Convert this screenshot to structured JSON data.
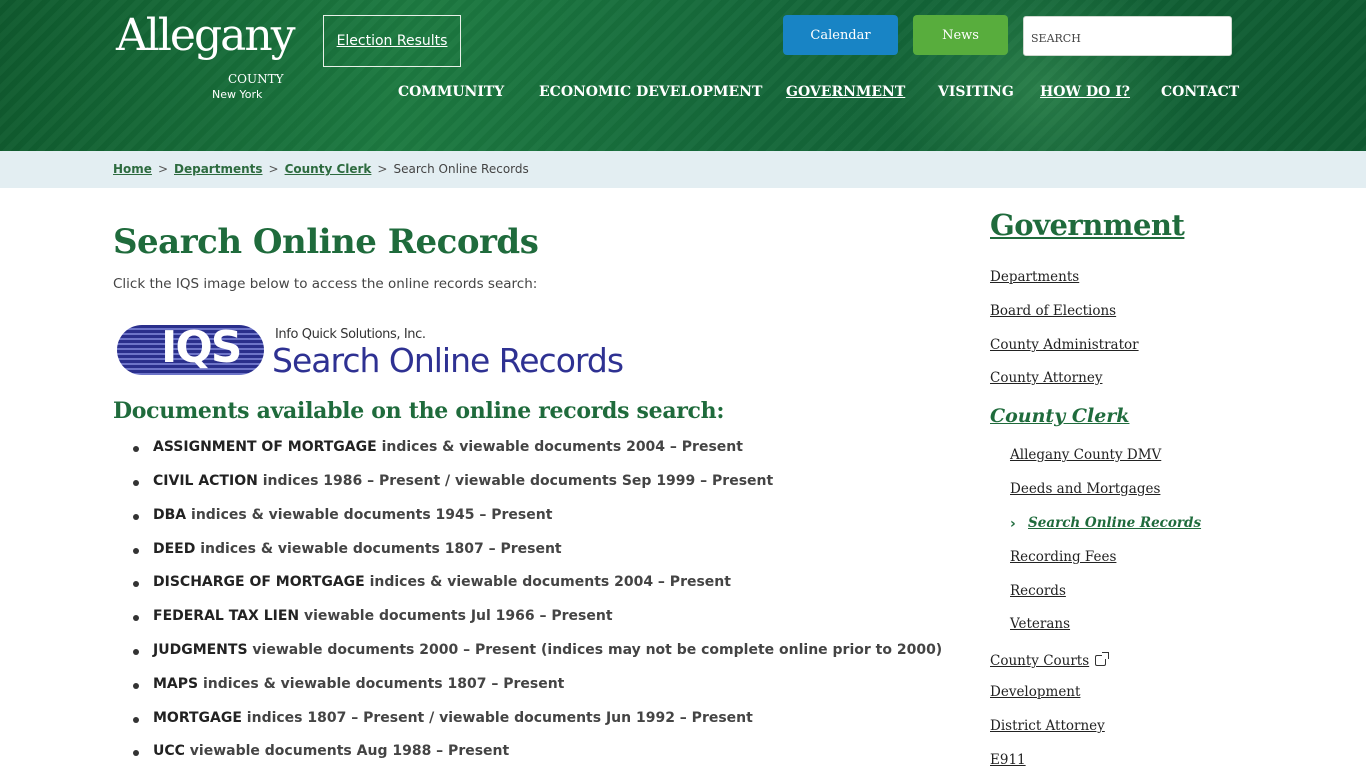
{
  "header": {
    "logo": {
      "word": "Allegany",
      "county": "COUNTY",
      "state": "New York"
    },
    "election_results": "Election Results",
    "calendar": "Calendar",
    "news": "News",
    "search_placeholder": "SEARCH",
    "nav": [
      "COMMUNITY",
      "ECONOMIC DEVELOPMENT",
      "GOVERNMENT",
      "VISITING",
      "HOW DO I?",
      "CONTACT"
    ],
    "colors": {
      "calendar": "#1884c5",
      "news": "#58ad3d",
      "header_bg": "#1d7a41"
    }
  },
  "breadcrumb": {
    "home": "Home",
    "departments": "Departments",
    "county_clerk": "County Clerk",
    "current": "Search Online Records",
    "separator": ">"
  },
  "main": {
    "title": "Search Online Records",
    "intro": "Click the IQS image below to access the online records search:",
    "iqs": {
      "letters": "IQS",
      "company": "Info Quick Solutions, Inc.",
      "caption": "Search Online Records"
    },
    "docs_heading": "Documents available on the online records search:",
    "documents": [
      {
        "name": "ASSIGNMENT OF MORTGAGE",
        "desc": "indices & viewable documents 2004 – Present"
      },
      {
        "name": "CIVIL ACTION",
        "desc": "indices 1986 – Present / viewable documents Sep 1999 – Present"
      },
      {
        "name": "DBA",
        "desc": "indices & viewable documents 1945 – Present"
      },
      {
        "name": "DEED",
        "desc": "indices & viewable documents 1807 – Present"
      },
      {
        "name": "DISCHARGE OF MORTGAGE",
        "desc": "indices & viewable documents 2004 – Present"
      },
      {
        "name": "FEDERAL TAX LIEN",
        "desc": "viewable documents Jul 1966 – Present"
      },
      {
        "name": "JUDGMENTS",
        "desc": "viewable documents 2000 – Present (indices may not be complete online prior to 2000)"
      },
      {
        "name": "MAPS",
        "desc": "indices & viewable documents 1807 – Present"
      },
      {
        "name": "MORTGAGE",
        "desc": "indices 1807 – Present / viewable documents Jun 1992 – Present"
      },
      {
        "name": "UCC",
        "desc": "viewable documents Aug 1988 – Present"
      }
    ]
  },
  "sidebar": {
    "title": "Government",
    "items": [
      "Departments",
      "Board of Elections",
      "County Administrator",
      "County Attorney",
      "County Clerk",
      "Allegany County DMV",
      "Deeds and Mortgages",
      "Search Online Records",
      "Recording Fees",
      "Records",
      "Veterans",
      "County Courts",
      "Development",
      "District Attorney",
      "E911"
    ]
  }
}
